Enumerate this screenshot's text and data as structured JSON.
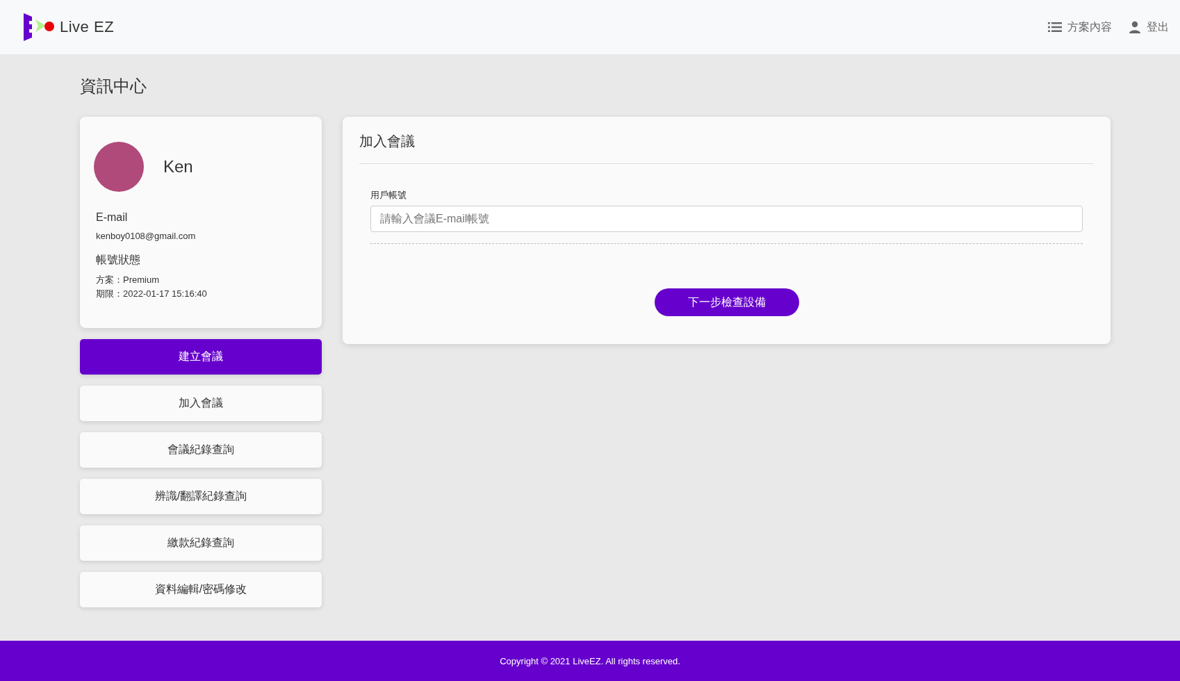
{
  "header": {
    "brand": "Live EZ",
    "nav": [
      {
        "kind": "plans",
        "label": "方案內容"
      },
      {
        "kind": "logout",
        "label": "登出"
      }
    ]
  },
  "page_title": "資訊中心",
  "profile": {
    "name": "Ken",
    "email_label": "E-mail",
    "email": "kenboy0108@gmail.com",
    "status_label": "帳號狀態",
    "plan": "方案：Premium",
    "expiry": "期限：2022-01-17 15:16:40"
  },
  "menu": [
    {
      "label": "建立會議",
      "selected": true
    },
    {
      "label": "加入會議",
      "selected": false
    },
    {
      "label": "會議紀錄查詢",
      "selected": false
    },
    {
      "label": "辨識/翻譯紀錄查詢",
      "selected": false
    },
    {
      "label": "繳款紀錄查詢",
      "selected": false
    },
    {
      "label": "資料編輯/密碼修改",
      "selected": false
    }
  ],
  "form": {
    "title": "加入會議",
    "field_label": "用戶帳號",
    "placeholder": "請輸入會議E-mail帳號",
    "submit": "下一步檢查設備"
  },
  "footer": "Copyright © 2021 LiveEZ. All rights reserved."
}
